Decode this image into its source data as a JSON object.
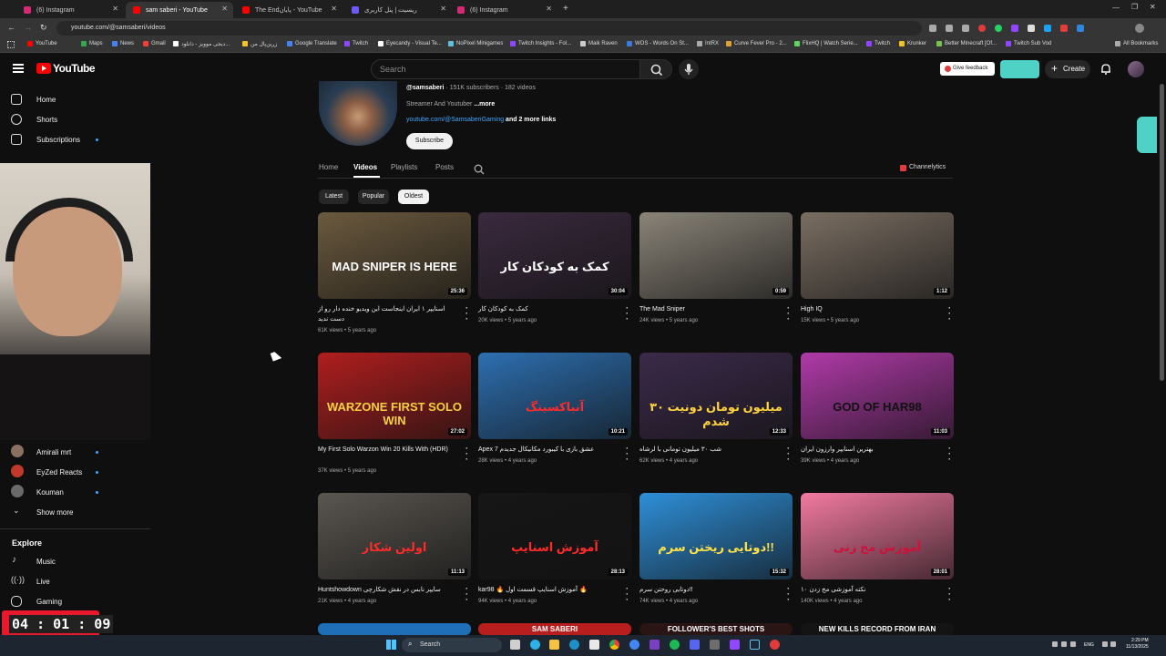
{
  "browser": {
    "tabs": [
      {
        "label": "(6) Instagram",
        "color": "#d62976"
      },
      {
        "label": "sam saberi - YouTube",
        "color": "#ff0000"
      },
      {
        "label": "The Endپایان - YouTube",
        "color": "#ff0000"
      },
      {
        "label": "ریسیت | پنل کاربری",
        "color": "#6b5bff"
      },
      {
        "label": "(6) Instagram",
        "color": "#d62976"
      }
    ],
    "url": "youtube.com/@samsaberi/videos",
    "bookmarks": [
      {
        "label": "YouTube",
        "color": "#ff0000"
      },
      {
        "label": "Maps",
        "color": "#34a853"
      },
      {
        "label": "News",
        "color": "#4285f4"
      },
      {
        "label": "Gmail",
        "color": "#ea4335"
      },
      {
        "label": "دیجی موویز - دانلود...",
        "color": "#ffffff"
      },
      {
        "label": "زرین‌پال من",
        "color": "#f4c430"
      },
      {
        "label": "Google Translate",
        "color": "#4285f4"
      },
      {
        "label": "Twitch",
        "color": "#9146ff"
      },
      {
        "label": "Eyecandy - Visual Te...",
        "color": "#ffffff"
      },
      {
        "label": "NoPixel Minigames",
        "color": "#5bc0de"
      },
      {
        "label": "Twitch Insights - Fol...",
        "color": "#9146ff"
      },
      {
        "label": "Maik Raven",
        "color": "#cccccc"
      },
      {
        "label": "WOS - Words On St...",
        "color": "#3a7bd5"
      },
      {
        "label": "IntRX",
        "color": "#aaaaaa"
      },
      {
        "label": "Curve Fever Pro - 2...",
        "color": "#e0a030"
      },
      {
        "label": "FlixHQ | Watch Serie...",
        "color": "#5fd35f"
      },
      {
        "label": "Twitch",
        "color": "#9146ff"
      },
      {
        "label": "Krunker",
        "color": "#f0c419"
      },
      {
        "label": "Better Minecraft [Of...",
        "color": "#7cbf4f"
      },
      {
        "label": "Twitch Sub Vod",
        "color": "#9146ff"
      },
      {
        "label": "All Bookmarks",
        "color": "#aaaaaa"
      }
    ]
  },
  "header": {
    "logo_text": "YouTube",
    "search_placeholder": "Search",
    "feedback_label": "Give feedback",
    "create_label": "Create"
  },
  "sidebar": {
    "main_items": [
      {
        "label": "Home",
        "icon": "home-icon"
      },
      {
        "label": "Shorts",
        "icon": "shorts-icon"
      },
      {
        "label": "Subscriptions",
        "icon": "subscriptions-icon"
      }
    ],
    "subscriptions": [
      {
        "label": "Amirali mrt",
        "color": "#8a7060"
      },
      {
        "label": "EyZed Reacts",
        "color": "#c0392b"
      },
      {
        "label": "Kouman",
        "color": "#6a6a6a"
      }
    ],
    "show_more": "Show more",
    "explore_title": "Explore",
    "explore_items": [
      {
        "label": "Music",
        "icon": "music-icon"
      },
      {
        "label": "Live",
        "icon": "live-icon"
      },
      {
        "label": "Gaming",
        "icon": "gaming-icon"
      }
    ]
  },
  "overlay": {
    "timer": "04 : 01 : 09"
  },
  "channel": {
    "handle": "@samsaberi",
    "stats": " · 151K subscribers · 182 videos",
    "description": "Streamer And Youtuber ",
    "more": "...more",
    "link": "youtube.com/@SamsaberiGaming",
    "link_more": " and 2 more links",
    "subscribe_label": "Subscribe",
    "tabs": [
      "Home",
      "Videos",
      "Playlists",
      "Posts"
    ],
    "active_tab": "Videos",
    "extension_label": "Channelytics",
    "chips": [
      "Latest",
      "Popular",
      "Oldest"
    ],
    "active_chip": "Oldest"
  },
  "videos": [
    {
      "title": "اسنایپر ۱ ایران اینجاست این ویدیو خنده دار رو از دست ندید",
      "meta": "61K views • 5 years ago",
      "duration": "25:36",
      "caption": "MAD SNIPER IS HERE",
      "bg": "#6b5a3e",
      "cap_color": "#ffffff"
    },
    {
      "title": "کمک به کودکان کار",
      "meta": "20K views • 5 years ago",
      "duration": "30:04",
      "caption": "کمک به کودکان کار",
      "bg": "#3a2a3e",
      "cap_color": "#ffffff"
    },
    {
      "title": "The Mad Sniper",
      "meta": "24K views • 5 years ago",
      "duration": "0:59",
      "caption": "",
      "bg": "#8a8478",
      "cap_color": "#ffffff"
    },
    {
      "title": "High IQ",
      "meta": "15K views • 5 years ago",
      "duration": "1:12",
      "caption": "",
      "bg": "#7a6e62",
      "cap_color": "#ffffff"
    },
    {
      "title": "My First Solo Warzon Win 20 Kills With (HDR)",
      "meta": "37K views • 5 years ago",
      "duration": "27:02",
      "caption": "WARZONE FIRST SOLO WIN",
      "bg": "#b01e1e",
      "cap_color": "#f5d142"
    },
    {
      "title": "Apex 7 عشق بازی با کیبورد مکانیکال جدیدم",
      "meta": "28K views • 4 years ago",
      "duration": "10:21",
      "caption": "آنباکسینگ",
      "bg": "#2d6fb0",
      "cap_color": "#ff2a2a"
    },
    {
      "title": "شب ۳۰ میلیون تومانی با لرشاه",
      "meta": "62K views • 4 years ago",
      "duration": "12:33",
      "caption": "۳۰ میلیون تومان دونیت شدم",
      "bg": "#3b2a4a",
      "cap_color": "#ffd23f"
    },
    {
      "title": "بهترین اسنایپر وارزون ایران",
      "meta": "39K views • 4 years ago",
      "duration": "11:03",
      "caption": "GOD OF HAR98",
      "bg": "#b03aa8",
      "cap_color": "#111111"
    },
    {
      "title": "Huntshowdown سایپر نابس در نقش شکارچی",
      "meta": "21K views • 4 years ago",
      "duration": "11:13",
      "caption": "اولین شکار",
      "bg": "#5a5650",
      "cap_color": "#ff2a2a"
    },
    {
      "title": "kar98 🔥 آموزش اسنایپ قسمت اول 🔥",
      "meta": "94K views • 4 years ago",
      "duration": "28:13",
      "caption": "آموزش اسنایپ",
      "bg": "#161616",
      "cap_color": "#ff2a2a"
    },
    {
      "title": "دوتایی روحتن سرم!!",
      "meta": "74K views • 4 years ago",
      "duration": "15:32",
      "caption": "دوتایی ریختن سرم!!",
      "bg": "#2e8fd8",
      "cap_color": "#ffe14a"
    },
    {
      "title": "نکته آموزشی مخ زدن ۱۰",
      "meta": "140K views • 4 years ago",
      "duration": "28:01",
      "caption": "آموزش مخ زنی",
      "bg": "#f27aa0",
      "cap_color": "#d0103a"
    }
  ],
  "bottom_row_captions": [
    "",
    "SAM SABERI",
    "FOLLOWER'S BEST SHOTS",
    "NEW KILLS RECORD FROM IRAN"
  ],
  "taskbar": {
    "search_label": "Search",
    "lang": "ENG",
    "time": "2:29 PM",
    "date": "11/13/2025"
  }
}
